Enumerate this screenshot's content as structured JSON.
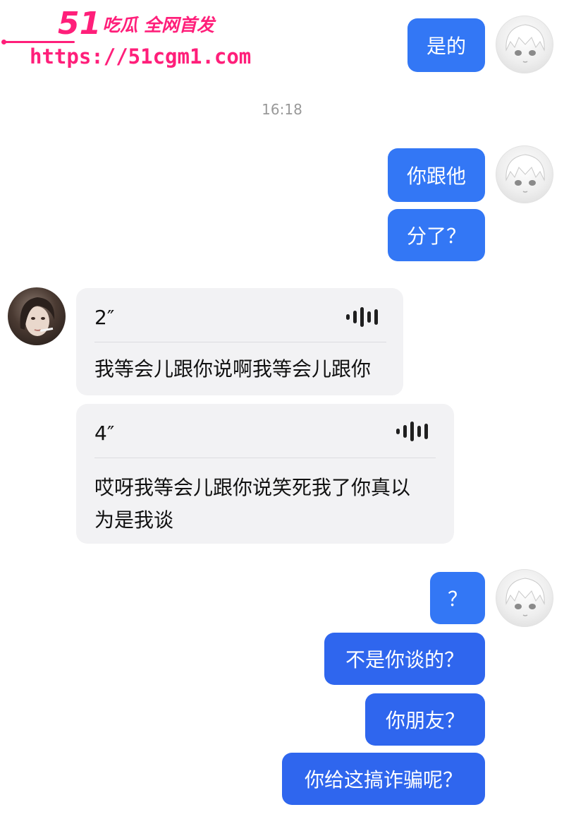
{
  "watermark": {
    "number": "51",
    "tagline": "吃瓜 全网首发",
    "url": "https://51cgm1.com"
  },
  "timestamp": "16:18",
  "messages": {
    "sent_1": "是的",
    "sent_2": "你跟他",
    "sent_3": "分了？",
    "voice_1": {
      "duration": "2″",
      "transcript": "我等会儿跟你说啊我等会儿跟你"
    },
    "voice_2": {
      "duration": "4″",
      "transcript_line1": "哎呀我等会儿跟你说笑死我了你真以",
      "transcript_line2": "为是我谈"
    },
    "sent_4": "？",
    "sent_5": "不是你谈的？",
    "sent_6": "你朋友？",
    "sent_7": "你给这搞诈骗呢？"
  },
  "colors": {
    "bubble_out": "#3377f5",
    "bubble_out_dark": "#2f66ee",
    "bubble_in": "#f2f2f4",
    "watermark": "#ff1f7a",
    "timestamp": "#999999"
  },
  "icons": {
    "my_avatar": "anime-girl-avatar",
    "peer_avatar": "woman-photo-avatar",
    "voice": "waveform-icon"
  }
}
